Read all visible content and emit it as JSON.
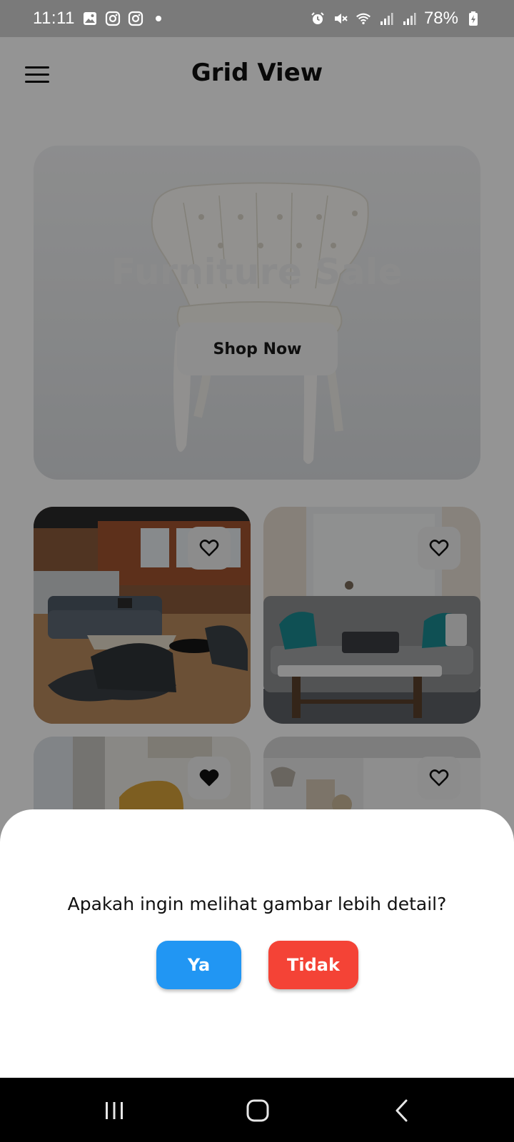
{
  "status_bar": {
    "time": "11:11",
    "battery": "78%",
    "left_icons": [
      "gallery-icon",
      "instagram-icon",
      "instagram-icon",
      "dot-icon"
    ],
    "right_icons": [
      "alarm-icon",
      "mute-icon",
      "wifi-icon",
      "signal-icon",
      "signal-icon",
      "battery-charging-icon"
    ]
  },
  "header": {
    "title": "Grid View",
    "menu_icon": "menu-icon"
  },
  "banner": {
    "title": "Furniture Sale",
    "button_label": "Shop Now"
  },
  "grid": {
    "cards": [
      {
        "favorite": false,
        "icon": "heart-outline-icon"
      },
      {
        "favorite": false,
        "icon": "heart-outline-icon"
      },
      {
        "favorite": true,
        "icon": "heart-filled-icon"
      },
      {
        "favorite": false,
        "icon": "heart-outline-icon"
      }
    ]
  },
  "dialog": {
    "question": "Apakah ingin melihat gambar lebih detail?",
    "yes_label": "Ya",
    "no_label": "Tidak"
  },
  "colors": {
    "yes_button": "#2196F3",
    "no_button": "#F44336",
    "status_bar": "#7A7A7A",
    "scrim": "rgba(0,0,0,0.42)"
  },
  "nav_bar": {
    "icons": [
      "recents-icon",
      "home-icon",
      "back-icon"
    ]
  }
}
